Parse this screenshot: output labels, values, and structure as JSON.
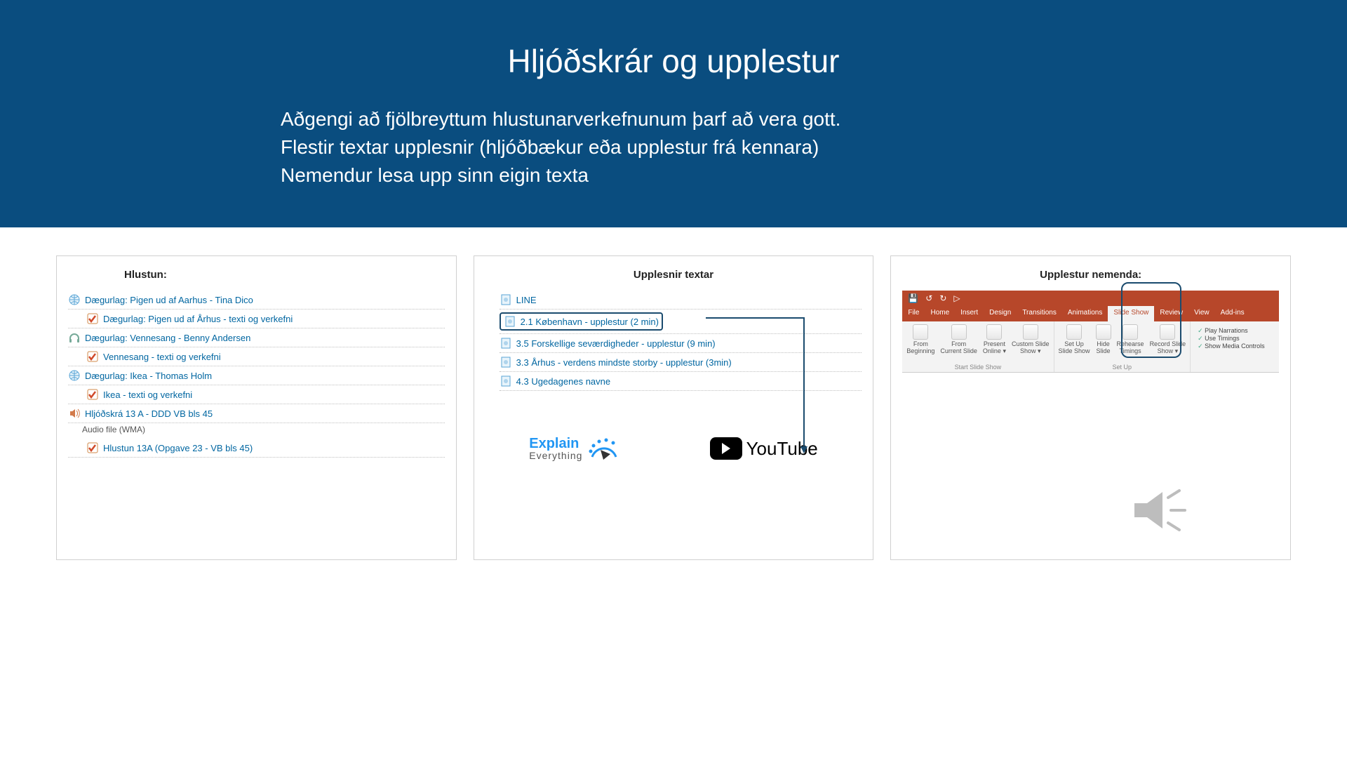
{
  "header": {
    "title": "Hljóðskrár og upplestur",
    "line1": "Aðgengi að fjölbreyttum hlustunarverkefnunum þarf að vera gott.",
    "line2": "Flestir textar upplesnir (hljóðbækur eða upplestur frá kennara)",
    "line3": "Nemendur lesa upp sinn eigin texta"
  },
  "panel1": {
    "title": "Hlustun:",
    "items": [
      {
        "icon": "globe",
        "text": "Dægurlag: Pigen ud af Aarhus - Tina Dico",
        "indent": false
      },
      {
        "icon": "check",
        "text": "Dægurlag: Pigen ud af Århus - texti og verkefni",
        "indent": true
      },
      {
        "icon": "headphones",
        "text": "Dægurlag: Vennesang - Benny Andersen",
        "indent": false
      },
      {
        "icon": "check",
        "text": "Vennesang - texti og verkefni",
        "indent": true
      },
      {
        "icon": "globe",
        "text": "Dægurlag: Ikea - Thomas Holm",
        "indent": false
      },
      {
        "icon": "check",
        "text": "Ikea - texti og verkefni",
        "indent": true
      },
      {
        "icon": "audio",
        "text": "Hljóðskrá 13 A - DDD VB bls 45",
        "indent": false
      }
    ],
    "subtext": "Audio file (WMA)",
    "last": {
      "icon": "check",
      "text": "Hlustun 13A (Opgave 23 - VB bls 45)",
      "indent": true
    }
  },
  "panel2": {
    "title": "Upplesnir textar",
    "items": [
      {
        "text": "LINE",
        "boxed": false
      },
      {
        "text": "2.1 København - upplestur (2 min)",
        "boxed": true
      },
      {
        "text": "3.5 Forskellige seværdigheder - upplestur (9 min)",
        "boxed": false
      },
      {
        "text": "3.3 Århus - verdens mindste storby - upplestur (3min)",
        "boxed": false
      },
      {
        "text": "4.3 Ugedagenes navne",
        "boxed": false
      }
    ],
    "explain_top": "Explain",
    "explain_bot": "Everything",
    "youtube": "YouTube"
  },
  "panel3": {
    "title": "Upplestur nemenda:",
    "tabs": [
      "File",
      "Home",
      "Insert",
      "Design",
      "Transitions",
      "Animations",
      "Slide Show",
      "Review",
      "View",
      "Add-ins"
    ],
    "active_tab_index": 6,
    "group1": {
      "btns": [
        "From\nBeginning",
        "From\nCurrent Slide",
        "Present\nOnline ▾",
        "Custom Slide\nShow ▾"
      ],
      "label": "Start Slide Show"
    },
    "group2": {
      "btns": [
        "Set Up\nSlide Show",
        "Hide\nSlide",
        "Rehearse\nTimings",
        "Record Slide\nShow ▾"
      ],
      "label": "Set Up"
    },
    "checks": [
      "Play Narrations",
      "Use Timings",
      "Show Media Controls"
    ]
  }
}
